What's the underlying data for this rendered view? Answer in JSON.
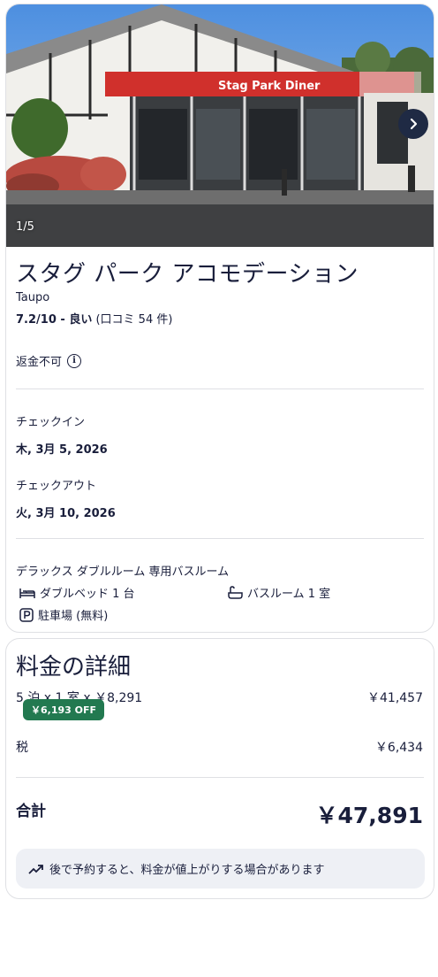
{
  "property": {
    "photo": {
      "counter": "1/5",
      "sign_text": "Stag Park Diner"
    },
    "name": "スタグ パーク アコモデーション",
    "city": "Taupo",
    "rating_score": "7.2/10 - 良い",
    "rating_reviews": "(口コミ 54 件)",
    "refund_policy": "返金不可",
    "checkin_label": "チェックイン",
    "checkin_date": "木, 3月 5, 2026",
    "checkout_label": "チェックアウト",
    "checkout_date": "火, 3月 10, 2026",
    "room_name": "デラックス ダブルルーム 専用バスルーム",
    "amenities": {
      "bed": "ダブルベッド 1 台",
      "bathroom": "バスルーム 1 室",
      "parking": "駐車場 (無料)"
    }
  },
  "price": {
    "title": "料金の詳細",
    "nights_line": "5 泊 x 1 室 x ￥8,291",
    "nights_total": "￥41,457",
    "discount_badge": "￥6,193 OFF",
    "tax_label": "税",
    "tax_value": "￥6,434",
    "total_label": "合計",
    "total_value": "￥47,891",
    "notice": "後で予約すると、料金が値上がりする場合があります"
  },
  "colors": {
    "text": "#191e3b",
    "divider": "#dfe0e4",
    "badge_green": "#227950",
    "notice_bg": "#eef0f5",
    "sign_red": "#d0302c"
  },
  "icons": [
    "info-icon",
    "bed-icon",
    "bathtub-icon",
    "parking-icon",
    "trending-up-icon",
    "chevron-right-icon"
  ]
}
